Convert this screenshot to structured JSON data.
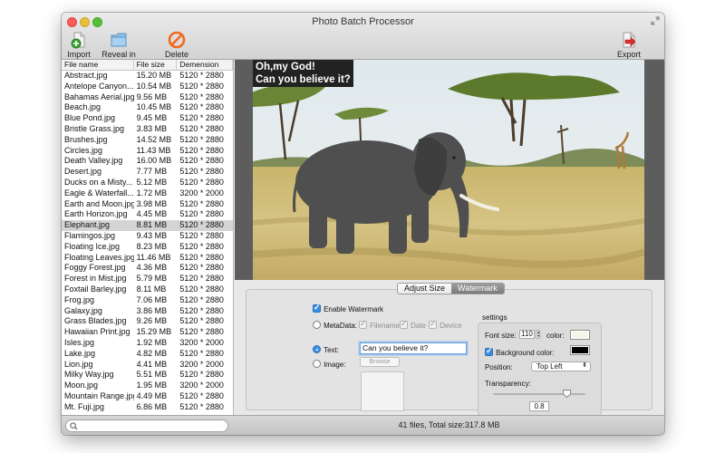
{
  "window": {
    "title": "Photo Batch Processor"
  },
  "toolbar": {
    "import_label": "Import",
    "reveal_label": "Reveal in Finder",
    "delete_label": "Delete",
    "export_label": "Export"
  },
  "table": {
    "headers": [
      "File name",
      "File size",
      "Demension"
    ],
    "selected_file": "Elephant.jpg",
    "rows": [
      [
        "Abstract.jpg",
        "15.20 MB",
        "5120 * 2880"
      ],
      [
        "Antelope Canyon...",
        "10.54 MB",
        "5120 * 2880"
      ],
      [
        "Bahamas Aerial.jpg",
        "9.56 MB",
        "5120 * 2880"
      ],
      [
        "Beach.jpg",
        "10.45 MB",
        "5120 * 2880"
      ],
      [
        "Blue Pond.jpg",
        "9.45 MB",
        "5120 * 2880"
      ],
      [
        "Bristle Grass.jpg",
        "3.83 MB",
        "5120 * 2880"
      ],
      [
        "Brushes.jpg",
        "14.52 MB",
        "5120 * 2880"
      ],
      [
        "Circles.jpg",
        "11.43 MB",
        "5120 * 2880"
      ],
      [
        "Death Valley.jpg",
        "16.00 MB",
        "5120 * 2880"
      ],
      [
        "Desert.jpg",
        "7.77 MB",
        "5120 * 2880"
      ],
      [
        "Ducks on a Misty...",
        "5.12 MB",
        "5120 * 2880"
      ],
      [
        "Eagle & Waterfall...",
        "1.72 MB",
        "3200 * 2000"
      ],
      [
        "Earth and Moon.jpg",
        "3.98 MB",
        "5120 * 2880"
      ],
      [
        "Earth Horizon.jpg",
        "4.45 MB",
        "5120 * 2880"
      ],
      [
        "Elephant.jpg",
        "8.81 MB",
        "5120 * 2880"
      ],
      [
        "Flamingos.jpg",
        "9.43 MB",
        "5120 * 2880"
      ],
      [
        "Floating Ice.jpg",
        "8.23 MB",
        "5120 * 2880"
      ],
      [
        "Floating Leaves.jpg",
        "11.46 MB",
        "5120 * 2880"
      ],
      [
        "Foggy Forest.jpg",
        "4.36 MB",
        "5120 * 2880"
      ],
      [
        "Forest in Mist.jpg",
        "5.79 MB",
        "5120 * 2880"
      ],
      [
        "Foxtail Barley.jpg",
        "8.11 MB",
        "5120 * 2880"
      ],
      [
        "Frog.jpg",
        "7.06 MB",
        "5120 * 2880"
      ],
      [
        "Galaxy.jpg",
        "3.86 MB",
        "5120 * 2880"
      ],
      [
        "Grass Blades.jpg",
        "9.26 MB",
        "5120 * 2880"
      ],
      [
        "Hawaiian Print.jpg",
        "15.29 MB",
        "5120 * 2880"
      ],
      [
        "Isles.jpg",
        "1.92 MB",
        "3200 * 2000"
      ],
      [
        "Lake.jpg",
        "4.82 MB",
        "5120 * 2880"
      ],
      [
        "Lion.jpg",
        "4.41 MB",
        "3200 * 2000"
      ],
      [
        "Milky Way.jpg",
        "5.51 MB",
        "5120 * 2880"
      ],
      [
        "Moon.jpg",
        "1.95 MB",
        "3200 * 2000"
      ],
      [
        "Mountain Range.jpg",
        "4.49 MB",
        "5120 * 2880"
      ],
      [
        "Mt. Fuji.jpg",
        "6.86 MB",
        "5120 * 2880"
      ]
    ]
  },
  "preview": {
    "watermark_line1": "Oh,my God!",
    "watermark_line2": "Can you believe it?"
  },
  "tabs": [
    {
      "label": "Adjust Size",
      "active": false
    },
    {
      "label": "Watermark",
      "active": true
    }
  ],
  "watermark": {
    "enable_label": "Enable Watermark",
    "enabled": true,
    "metadata_label": "MetaData:",
    "metadata_options": [
      "Filename",
      "Date",
      "Device"
    ],
    "text_label": "Text:",
    "text_value": "Can you believe it?",
    "image_label": "Image:",
    "browse_label": "Browse",
    "selected_mode": "text"
  },
  "settings": {
    "title": "settings",
    "font_size_label": "Font size:",
    "font_size_value": "110",
    "color_label": "color:",
    "font_color": "#f7f5e8",
    "bg_color_label": "Background color:",
    "bg_color_enabled": true,
    "bg_color": "#000000",
    "position_label": "Position:",
    "position_value": "Top Left",
    "transparency_label": "Transparency:",
    "transparency_value": "0.8",
    "transparency_level": 0.8
  },
  "statusbar": {
    "summary": "41 files, Total size:317.8 MB",
    "search_placeholder": ""
  },
  "colors": {
    "selection": "#d4d4d4",
    "focus_ring": "#6c9fd9",
    "tab_active": "#8a8a8a",
    "delete_icon": "#f06a1e",
    "export_icon": "#d92f2f"
  }
}
